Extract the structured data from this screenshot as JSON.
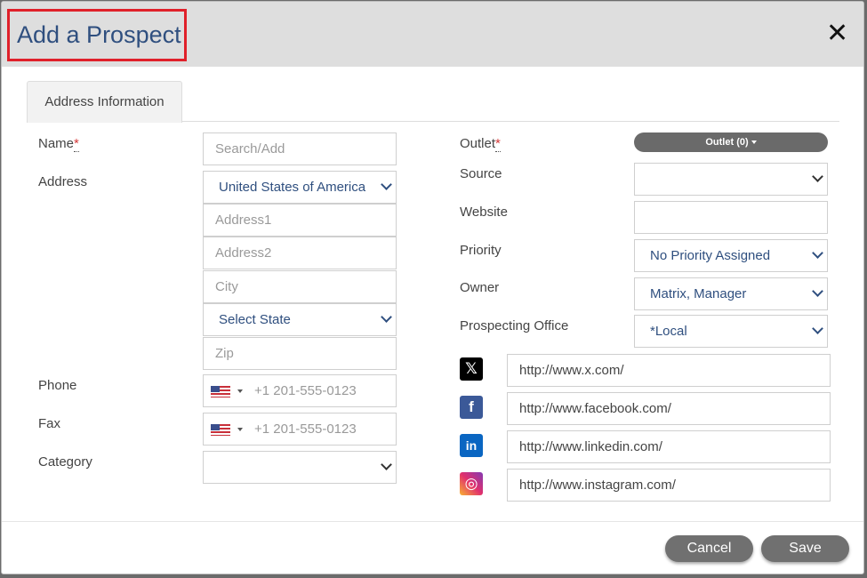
{
  "modal": {
    "title": "Add a Prospect",
    "close_label": "✕"
  },
  "tabs": [
    {
      "label": "Address Information"
    }
  ],
  "left": {
    "name_label": "Name",
    "name_placeholder": "Search/Add",
    "address_label": "Address",
    "country_value": "United States of America",
    "address1_placeholder": "Address1",
    "address2_placeholder": "Address2",
    "city_placeholder": "City",
    "state_value": "Select State",
    "zip_placeholder": "Zip",
    "phone_label": "Phone",
    "phone_placeholder": "+1 201-555-0123",
    "fax_label": "Fax",
    "fax_placeholder": "+1 201-555-0123",
    "category_label": "Category",
    "category_value": ""
  },
  "right": {
    "outlet_label": "Outlet",
    "outlet_button": "Outlet (0)",
    "source_label": "Source",
    "source_value": "",
    "website_label": "Website",
    "website_value": "",
    "priority_label": "Priority",
    "priority_value": "No Priority Assigned",
    "owner_label": "Owner",
    "owner_value": "Matrix, Manager",
    "office_label": "Prospecting Office",
    "office_value": "*Local"
  },
  "social": [
    {
      "icon": "x-icon",
      "value": "http://www.x.com/",
      "color": "#000000",
      "glyph": "𝕏"
    },
    {
      "icon": "facebook-icon",
      "value": "http://www.facebook.com/",
      "color": "#3b5998",
      "glyph": "f"
    },
    {
      "icon": "linkedin-icon",
      "value": "http://www.linkedin.com/",
      "color": "#0a66c2",
      "glyph": "in"
    },
    {
      "icon": "instagram-icon",
      "value": "http://www.instagram.com/",
      "color": "#e1306c",
      "glyph": "◎"
    }
  ],
  "footer": {
    "cancel_label": "Cancel",
    "save_label": "Save"
  },
  "colors": {
    "title": "#2f4f7f",
    "title_outline": "#e0202a",
    "button": "#707070",
    "required": "#d43a3a"
  }
}
